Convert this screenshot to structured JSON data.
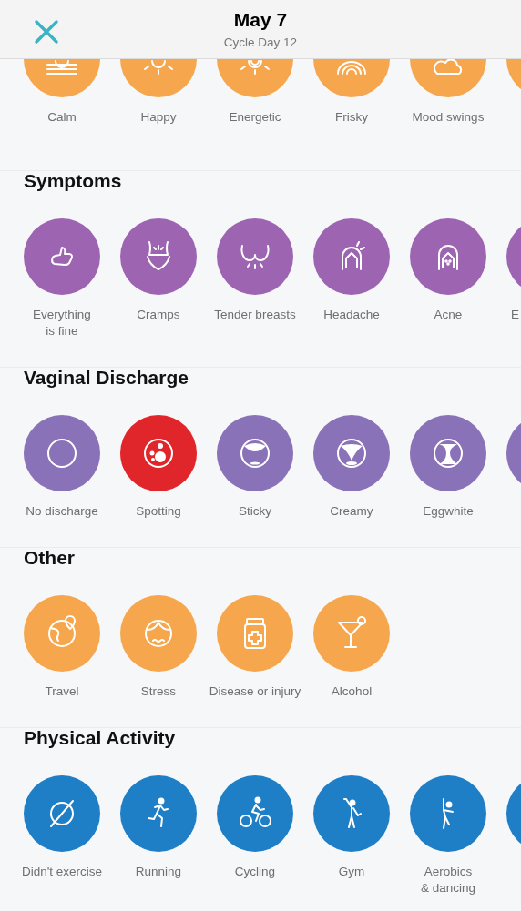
{
  "header": {
    "title": "May 7",
    "subtitle": "Cycle Day 12"
  },
  "sections": [
    {
      "color": "#f6a64c",
      "items": [
        {
          "label": "Calm",
          "selected": false
        },
        {
          "label": "Happy",
          "selected": false
        },
        {
          "label": "Energetic",
          "selected": false
        },
        {
          "label": "Frisky",
          "selected": false
        },
        {
          "label": "Mood swings",
          "selected": false
        },
        {
          "selected": false
        }
      ]
    },
    {
      "title": "Symptoms",
      "color": "#9d65b1",
      "items": [
        {
          "label": "Everything\nis fine",
          "selected": false
        },
        {
          "label": "Cramps",
          "selected": false
        },
        {
          "label": "Tender breasts",
          "selected": false
        },
        {
          "label": "Headache",
          "selected": false
        },
        {
          "label": "Acne",
          "selected": false
        },
        {
          "label": "E",
          "selected": false
        }
      ]
    },
    {
      "title": "Vaginal Discharge",
      "color": "#8a72b8",
      "items": [
        {
          "label": "No discharge",
          "selected": false
        },
        {
          "label": "Spotting",
          "selected": true
        },
        {
          "label": "Sticky",
          "selected": false
        },
        {
          "label": "Creamy",
          "selected": false
        },
        {
          "label": "Eggwhite",
          "selected": false
        },
        {
          "selected": false
        }
      ]
    },
    {
      "title": "Other",
      "color": "#f6a64c",
      "items": [
        {
          "label": "Travel",
          "selected": false
        },
        {
          "label": "Stress",
          "selected": false
        },
        {
          "label": "Disease or injury",
          "selected": false
        },
        {
          "label": "Alcohol",
          "selected": false
        }
      ]
    },
    {
      "title": "Physical Activity",
      "color": "#1e7ec6",
      "items": [
        {
          "label": "Didn't exercise",
          "selected": false
        },
        {
          "label": "Running",
          "selected": false
        },
        {
          "label": "Cycling",
          "selected": false
        },
        {
          "label": "Gym",
          "selected": false
        },
        {
          "label": "Aerobics\n& dancing",
          "selected": false
        },
        {
          "selected": false
        }
      ]
    }
  ]
}
